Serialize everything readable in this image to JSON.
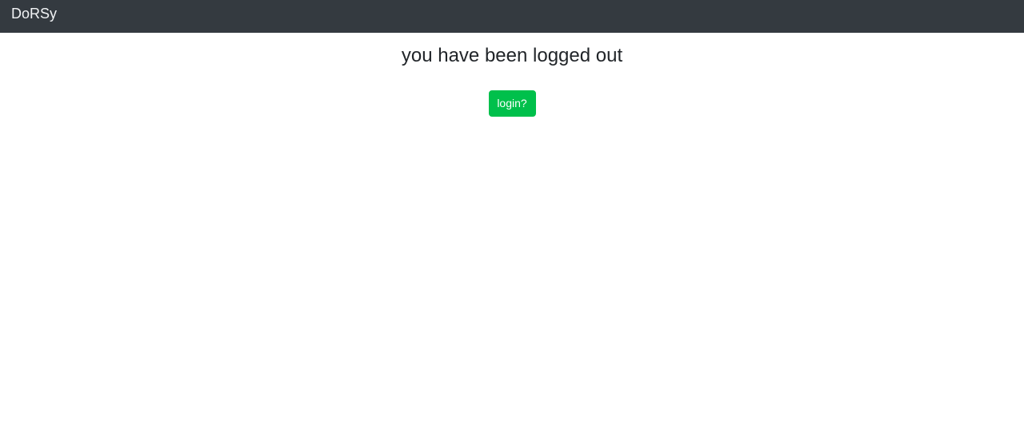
{
  "navbar": {
    "brand": "DoRSy"
  },
  "main": {
    "title": "you have been logged out",
    "login_button_label": "login?"
  },
  "colors": {
    "navbar_background": "#343a40",
    "button_background": "#00c04b"
  }
}
